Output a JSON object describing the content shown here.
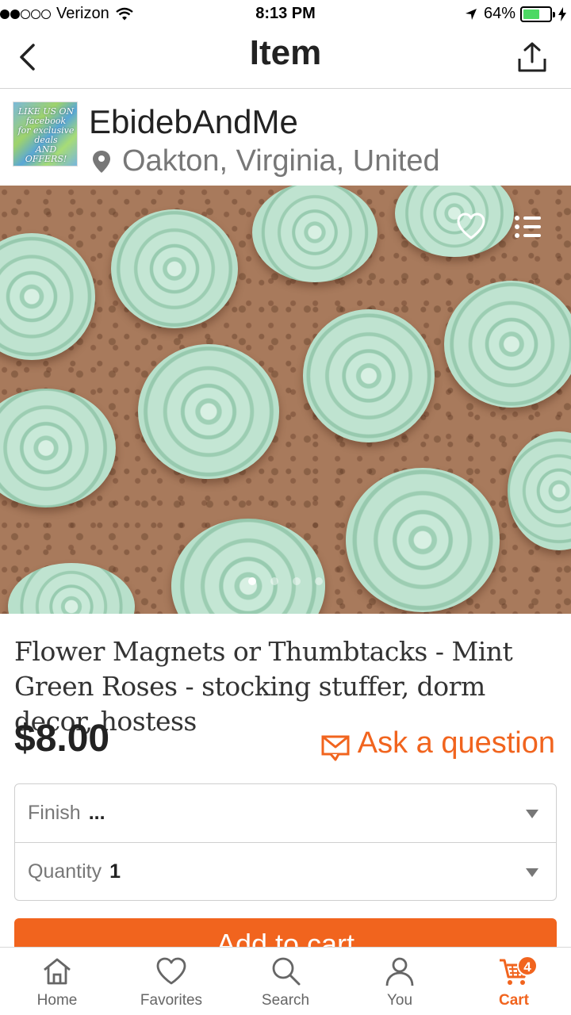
{
  "status_bar": {
    "carrier": "Verizon",
    "time": "8:13 PM",
    "battery_percent": "64%",
    "battery_level": 0.64,
    "signal_bars": 2,
    "signal_total": 5
  },
  "header": {
    "title": "Item",
    "back_icon": "chevron-left-icon",
    "share_icon": "share-icon"
  },
  "shop": {
    "name": "EbidebAndMe",
    "location": "Oakton, Virginia, United",
    "avatar_text": "LIKE US ON facebook for exclusive deals AND OFFERS!"
  },
  "hero": {
    "image_description": "mint-green-rose-thumbtacks-on-cork",
    "favorite_icon": "heart-outline-icon",
    "list_icon": "list-icon",
    "page_count": 4,
    "active_page": 0
  },
  "item": {
    "title": "Flower Magnets or Thumbtacks - Mint Green Roses - stocking stuffer, dorm decor, hostess",
    "price": "$8.00",
    "ask_label": "Ask a question"
  },
  "options": {
    "finish_label": "Finish",
    "finish_value": "...",
    "quantity_label": "Quantity",
    "quantity_value": "1"
  },
  "cart_button": {
    "label": "Add to cart"
  },
  "tabs": [
    {
      "label": "Home",
      "icon": "home-icon"
    },
    {
      "label": "Favorites",
      "icon": "heart-icon"
    },
    {
      "label": "Search",
      "icon": "search-icon"
    },
    {
      "label": "You",
      "icon": "user-icon"
    },
    {
      "label": "Cart",
      "icon": "cart-icon",
      "badge": "4"
    }
  ],
  "colors": {
    "accent": "#f1641e",
    "text": "#222222",
    "muted": "#777777",
    "rose": "#a8d8c0",
    "cork": "#a87a5c"
  }
}
